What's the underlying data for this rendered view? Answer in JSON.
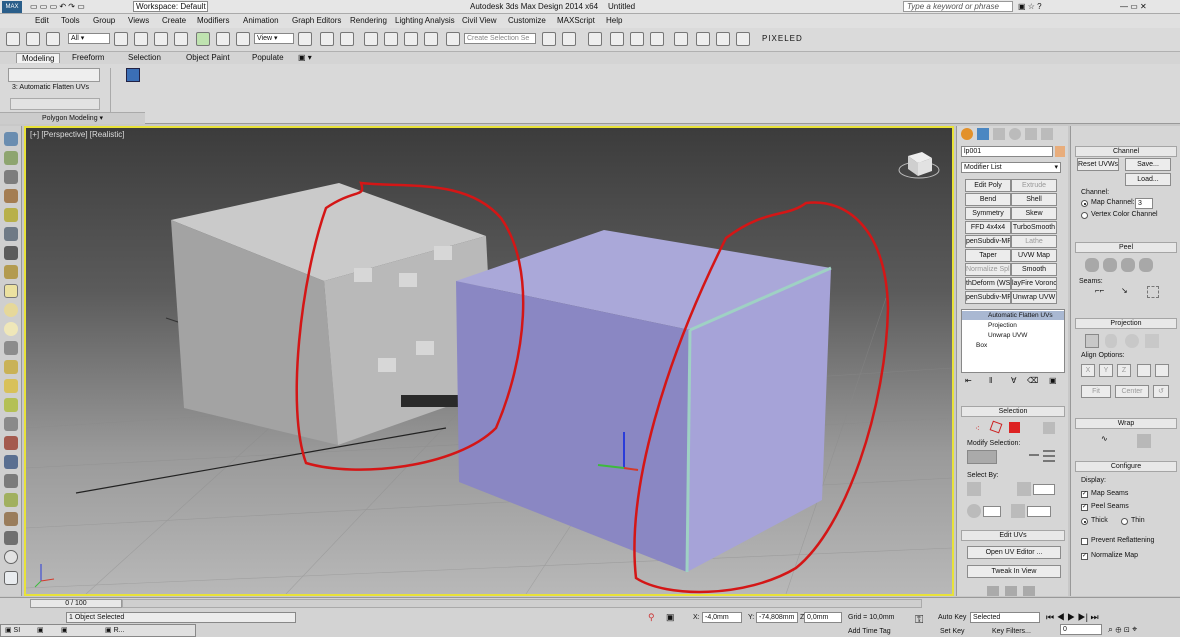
{
  "titlebar": {
    "workspace": "Workspace: Default",
    "app_title": "Autodesk 3ds Max Design 2014 x64",
    "doc_title": "Untitled",
    "search_placeholder": "Type a keyword or phrase"
  },
  "menu": [
    "Edit",
    "Tools",
    "Group",
    "Views",
    "Create",
    "Modifiers",
    "Animation",
    "Graph Editors",
    "Rendering",
    "Lighting Analysis",
    "Civil View",
    "Customize",
    "MAXScript",
    "Help"
  ],
  "toolbar": {
    "filter": "All",
    "coord": "View",
    "selection_set_placeholder": "Create Selection Se",
    "brand": "PIXELED"
  },
  "ribbon": {
    "tabs": [
      "Modeling",
      "Freeform",
      "Selection",
      "Object Paint",
      "Populate"
    ],
    "active_tab": "Modeling",
    "modifier_label": "3: Automatic Flatten UVs",
    "panel": "Polygon Modeling"
  },
  "viewport": {
    "label": "[+] [Perspective] [Realistic]"
  },
  "cmd_panel": {
    "object_name": "lp001",
    "modifier_list": "Modifier List",
    "modifier_buttons": [
      [
        "Edit Poly",
        "Extrude"
      ],
      [
        "Bend",
        "Shell"
      ],
      [
        "Symmetry",
        "Skew"
      ],
      [
        "FFD 4x4x4",
        "TurboSmooth"
      ],
      [
        "penSubdiv-MP",
        "Lathe"
      ],
      [
        "Taper",
        "UVW Map"
      ],
      [
        "Normalize Spl.",
        "Smooth"
      ],
      [
        "thDeform (WSI",
        "layFire Voronc"
      ],
      [
        "penSubdiv-MP",
        "Unwrap UVW"
      ]
    ],
    "stack": [
      "Automatic Flatten UVs",
      "Projection",
      "Unwrap UVW",
      "Box"
    ],
    "selection_title": "Selection",
    "modify_selection": "Modify Selection:",
    "select_by": "Select By:",
    "edit_uvs_title": "Edit UVs",
    "open_uv_editor": "Open UV Editor ...",
    "tweak_in_view": "Tweak In View"
  },
  "rp": {
    "channel_title": "Channel",
    "reset_uvws": "Reset UVWs",
    "save": "Save...",
    "load": "Load...",
    "channel_label": "Channel:",
    "map_channel": "Map Channel:",
    "map_channel_value": "3",
    "vertex_color": "Vertex Color Channel",
    "peel_title": "Peel",
    "seams": "Seams:",
    "projection_title": "Projection",
    "align_options": "Align Options:",
    "align_x": "X",
    "align_y": "Y",
    "align_z": "Z",
    "fit": "Fit",
    "center": "Center",
    "wrap_title": "Wrap",
    "configure_title": "Configure",
    "display": "Display:",
    "map_seams": "Map Seams",
    "peel_seams": "Peel Seams",
    "thick": "Thick",
    "thin": "Thin",
    "prevent_reflattening": "Prevent Reflattening",
    "normalize_map": "Normalize Map"
  },
  "status": {
    "time": "0 / 100",
    "selected": "1 Object Selected",
    "x_label": "X:",
    "x": "-4,0mm",
    "y_label": "Y:",
    "y": "-74,808mm",
    "z_label": "Z:",
    "z": "0,0mm",
    "grid": "Grid = 10,0mm",
    "add_time_tag": "Add Time Tag",
    "auto_key": "Auto Key",
    "set_key": "Set Key",
    "key_mode": "Selected",
    "key_filters": "Key Filters...",
    "frame": "0",
    "taskbar_item": "R..."
  }
}
